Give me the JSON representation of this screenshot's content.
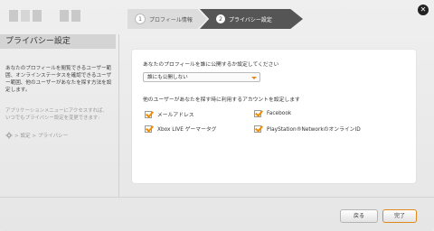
{
  "wizard": {
    "steps": [
      {
        "number": "1",
        "label": "プロフィール情報"
      },
      {
        "number": "2",
        "label": "プライバシー設定"
      }
    ],
    "close_icon": "close-icon"
  },
  "sidebar": {
    "title": "プライバシー設定",
    "description": "あなたのプロフィールを閲覧できるユーザー範囲、オンラインステータスを確認できるユーザー範囲、他のユーザーがあなたを探す方法を設定します。",
    "hint": "アプリケーションメニューにアクセスすれば、いつでもプライバシー設定を変更できます:",
    "path": "> 設定 > プライバシー",
    "path_icon": "gear-icon"
  },
  "form": {
    "profile_question": "あなたのプロフィールを誰に公開するか設定してください",
    "profile_select_value": "誰にも公開しない",
    "search_question": "他のユーザーがあなたを探す時に利用するアカウントを設定します",
    "options": [
      {
        "label": "メールアドレス",
        "checked": true
      },
      {
        "label": "Facebook",
        "checked": true
      },
      {
        "label": "Xbox LIVE ゲーマータグ",
        "checked": true
      },
      {
        "label": "PlayStation®NetworkのオンラインID",
        "checked": true
      }
    ]
  },
  "footer": {
    "back_label": "戻る",
    "done_label": "完了"
  },
  "colors": {
    "accent": "#f08c00",
    "step_active": "#555555"
  }
}
